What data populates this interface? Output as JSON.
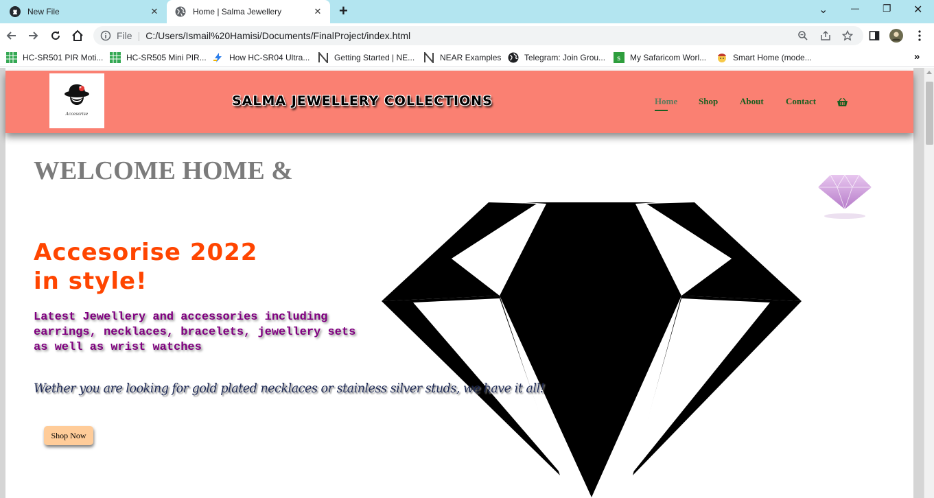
{
  "browser": {
    "tabs": [
      {
        "title": "New File",
        "icon": "github-icon",
        "active": false
      },
      {
        "title": "Home | Salma Jewellery",
        "icon": "globe-icon",
        "active": true
      }
    ],
    "tab_close": "✕",
    "new_tab": "+",
    "window_controls": {
      "dropdown": "⌄",
      "minimize": "—",
      "restore": "❐",
      "close": "✕"
    },
    "address": {
      "scheme_label": "File",
      "separator": "|",
      "url": "C:/Users/Ismail%20Hamisi/Documents/FinalProject/index.html"
    },
    "bookmarks": [
      {
        "label": "HC-SR501 PIR Moti...",
        "icon": "sheets-icon"
      },
      {
        "label": "HC-SR505 Mini PIR...",
        "icon": "sheets-icon"
      },
      {
        "label": "How HC-SR04 Ultra...",
        "icon": "lightning-icon"
      },
      {
        "label": "Getting Started | NE...",
        "icon": "near-icon"
      },
      {
        "label": "NEAR Examples",
        "icon": "near-icon"
      },
      {
        "label": "Telegram: Join Grou...",
        "icon": "globe-icon"
      },
      {
        "label": "My Safaricom Worl...",
        "icon": "safaricom-icon"
      },
      {
        "label": "Smart Home (mode...",
        "icon": "emoji-icon"
      }
    ],
    "bookmarks_more": "»",
    "colors": {
      "tabstrip": "#b3e5f0",
      "omnibox": "#f1f3f4"
    }
  },
  "site": {
    "logo_caption": "Accesorise",
    "title": "SALMA JEWELLERY COLLECTIONS",
    "nav": [
      {
        "label": "Home",
        "active": true
      },
      {
        "label": "Shop",
        "active": false
      },
      {
        "label": "About",
        "active": false
      },
      {
        "label": "Contact",
        "active": false
      }
    ],
    "cart_icon": "basket-icon",
    "colors": {
      "header": "#fa8072",
      "nav_text": "#1b5e20",
      "hero_title": "#ff4500",
      "hero_desc": "#800080",
      "button": "#ffcc99"
    }
  },
  "hero": {
    "welcome": "WELCOME HOME &",
    "title_line1": "Accesorise 2022",
    "title_line2": "in style!",
    "description_line1": "Latest Jewellery and accessories including",
    "description_line2": "earrings, necklaces, bracelets, jewellery sets",
    "description_line3": "as well as wrist watches",
    "tagline": "Wether you are looking for gold plated necklaces or stainless silver studs, we have it all!",
    "button": "Shop Now"
  }
}
